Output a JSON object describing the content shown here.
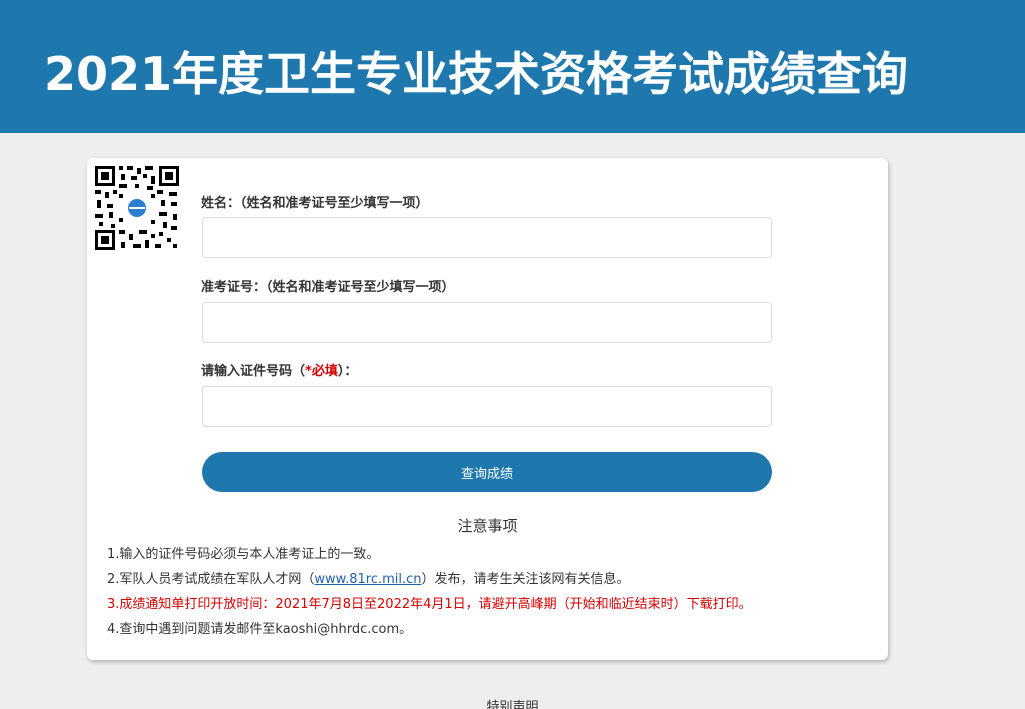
{
  "header": {
    "title": "2021年度卫生专业技术资格考试成绩查询"
  },
  "form": {
    "name_label": "姓名：（姓名和准考证号至少填写一项）",
    "ticket_label": "准考证号：（姓名和准考证号至少填写一项）",
    "id_label_prefix": "请输入证件号码（",
    "id_label_required": "*必填",
    "id_label_suffix": "）：",
    "name_value": "",
    "ticket_value": "",
    "id_value": "",
    "submit_label": "查询成绩"
  },
  "notes": {
    "title": "注意事项",
    "item1": "1.输入的证件号码必须与本人准考证上的一致。",
    "item2_prefix": "2.军队人员考试成绩在军队人才网（",
    "item2_link": "www.81rc.mil.cn",
    "item2_suffix": "）发布，请考生关注该网有关信息。",
    "item3": "3.成绩通知单打印开放时间：2021年7月8日至2022年4月1日，请避开高峰期（开始和临近结束时）下载打印。",
    "item4": "4.查询中遇到问题请发邮件至kaoshi@hhrdc.com。"
  },
  "footer": {
    "title": "特别声明"
  },
  "colors": {
    "brand": "#1e78ae",
    "required": "#d40000",
    "background": "#eeeeee"
  }
}
